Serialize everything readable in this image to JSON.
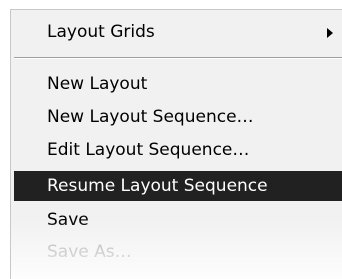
{
  "menu": {
    "items": [
      {
        "label": "Layout Grids",
        "submenu": true
      },
      {
        "label": "New Layout"
      },
      {
        "label": "New Layout Sequence…"
      },
      {
        "label": "Edit Layout Sequence…"
      },
      {
        "label": "Resume Layout Sequence",
        "selected": true
      },
      {
        "label": "Save"
      },
      {
        "label": "Save As…",
        "disabled": true
      }
    ]
  },
  "colors": {
    "menu_background": "#f1f1f1",
    "selection_background": "#212121",
    "selection_text": "#ffffff",
    "disabled_text": "#a8a8a8"
  },
  "icons": {
    "submenu": "submenu-arrow-icon"
  }
}
